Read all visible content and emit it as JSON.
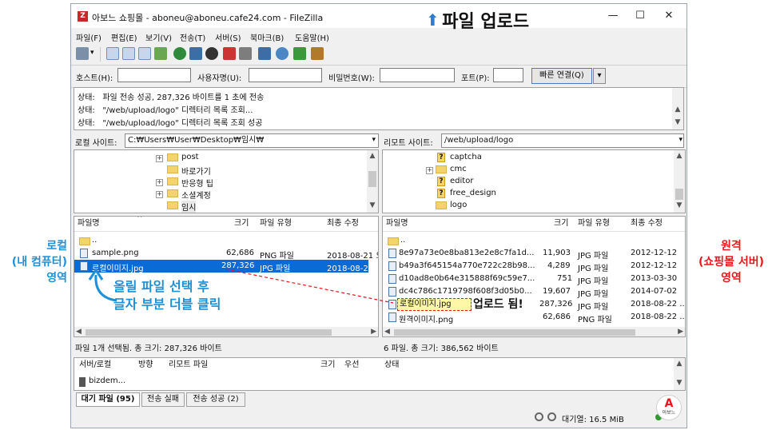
{
  "window": {
    "title": "아보느 쇼핑몰 - aboneu@aboneu.cafe24.com - FileZilla",
    "logo_letter": "Z",
    "minimize_glyph": "—",
    "maximize_glyph": "☐",
    "close_glyph": "✕"
  },
  "headline": {
    "arrow_glyph": "⬆",
    "text": "파일 업로드",
    "arrow_color": "#2f7dd1"
  },
  "menu": [
    "파일(F)",
    "편집(E)",
    "보기(V)",
    "전송(T)",
    "서버(S)",
    "북마크(B)",
    "도움말(H)"
  ],
  "quickconnect": {
    "host_label": "호스트(H):",
    "user_label": "사용자명(U):",
    "pass_label": "비밀번호(W):",
    "port_label": "포트(P):",
    "connect_label": "빠른 연결(Q)",
    "dropdown_glyph": "▾"
  },
  "log": [
    {
      "label": "상태:",
      "text": "파일 전송 성공, 287,326 바이트를 1 초에 전송"
    },
    {
      "label": "상태:",
      "text": "\"/web/upload/logo\" 디렉터리 목록 조회..."
    },
    {
      "label": "상태:",
      "text": "\"/web/upload/logo\" 디렉터리 목록 조회 성공"
    }
  ],
  "local": {
    "site_label": "로컬 사이트:",
    "path": "C:₩Users₩User₩Desktop₩임시₩",
    "tree": [
      "post",
      "바로가기",
      "반응형 팁",
      "소셜계정",
      "임시"
    ],
    "columns": {
      "name": "파일명",
      "size": "크기",
      "type": "파일 유형",
      "modified": "최종 수정"
    },
    "files": [
      {
        "name": "..",
        "size": "",
        "type": "",
        "modified": ""
      },
      {
        "name": "sample.png",
        "size": "62,686",
        "type": "PNG 파일",
        "modified": "2018-08-21 오"
      },
      {
        "name": "로컬이미지.jpg",
        "size": "287,326",
        "type": "JPG 파일",
        "modified": "2018-08-22 오"
      }
    ],
    "status": "파일 1개 선택됨. 총 크기: 287,326 바이트"
  },
  "remote": {
    "site_label": "리모트 사이트:",
    "path": "/web/upload/logo",
    "tree": [
      "captcha",
      "cmc",
      "editor",
      "free_design",
      "logo"
    ],
    "columns": {
      "name": "파일명",
      "size": "크기",
      "type": "파일 유형",
      "modified": "최종 수정"
    },
    "files": [
      {
        "name": "..",
        "size": "",
        "type": "",
        "modified": ""
      },
      {
        "name": "8e97a73e0e8ba813e2e8c7fa1d...",
        "size": "11,903",
        "type": "JPG 파일",
        "modified": "2012-12-12"
      },
      {
        "name": "b49a3f645154a770e722c28b98...",
        "size": "4,289",
        "type": "JPG 파일",
        "modified": "2012-12-12"
      },
      {
        "name": "d10ad8e0b64e315888f69c59e7...",
        "size": "751",
        "type": "JPG 파일",
        "modified": "2013-03-30"
      },
      {
        "name": "dc4c786c1719798f608f3d05b0...",
        "size": "19,607",
        "type": "JPG 파일",
        "modified": "2014-07-02"
      },
      {
        "name": "로컬이미지.jpg",
        "size": "287,326",
        "type": "JPG 파일",
        "modified": "2018-08-22 ..."
      },
      {
        "name": "원격이미지.png",
        "size": "62,686",
        "type": "PNG 파일",
        "modified": "2018-08-22 ..."
      }
    ],
    "status": "6 파일. 총 크기: 386,562 바이트"
  },
  "queue": {
    "columns": {
      "server": "서버/로컬",
      "direction": "방향",
      "remote": "리모트 파일",
      "size": "크기",
      "priority": "우선",
      "status": "상태"
    },
    "rows": [
      "bizdem..."
    ],
    "tabs": [
      "대기 파일 (95)",
      "전송 실패",
      "전송 성공 (2)"
    ],
    "footer": "대기열: 16.5 MiB"
  },
  "annotations": {
    "local_label": [
      "로컬",
      "(내 컴퓨터)",
      "영역"
    ],
    "remote_label": [
      "원격",
      "(쇼핑몰 서버)",
      "영역"
    ],
    "instruction": [
      "올릴 파일 선택 후",
      "글자 부분 더블 클릭"
    ],
    "uploaded": "업로드 됨!",
    "local_color": "#1e90d6",
    "remote_color": "#e8161d",
    "badge_letter": "A",
    "badge_caption": "아보느"
  }
}
